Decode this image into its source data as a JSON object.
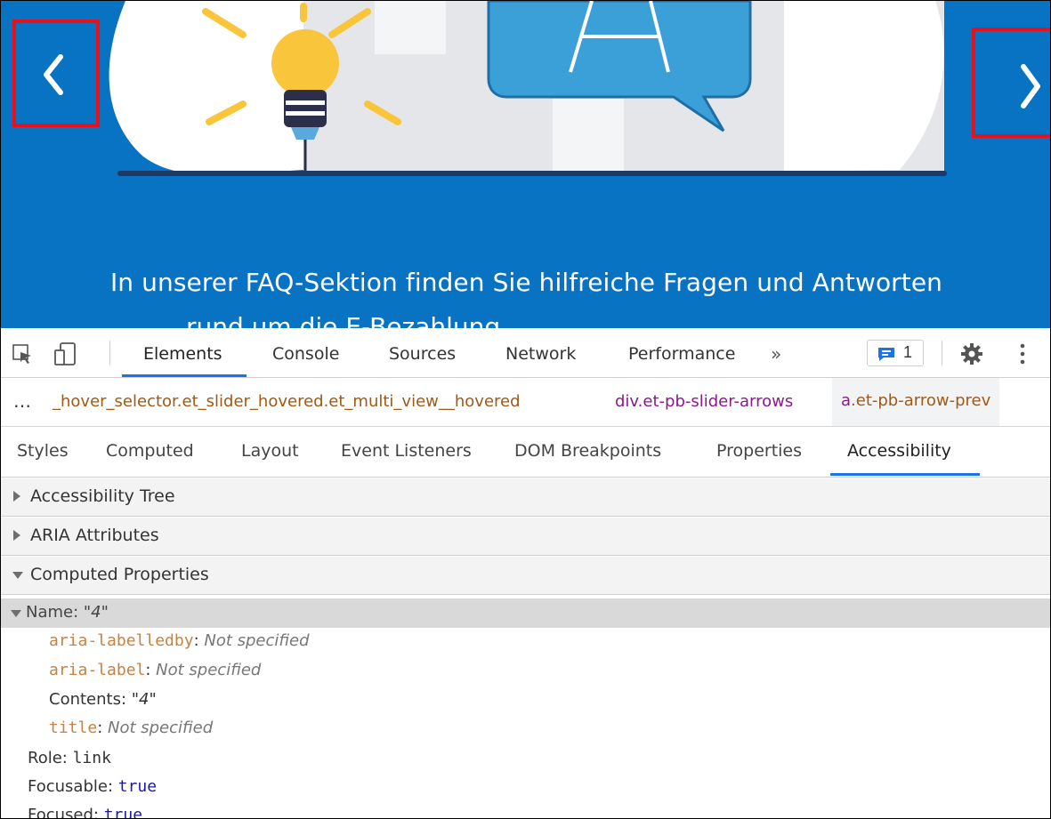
{
  "banner": {
    "headline": "In unserer FAQ-Sektion finden Sie hilfreiche Fragen und Antworten",
    "headline_cont": "rund um die E-Bezahlung",
    "colors": {
      "background": "#0872c3",
      "highlight": "#e8101a"
    },
    "prev_icon": "chevron-left-icon",
    "next_icon": "chevron-right-icon"
  },
  "toolbar": {
    "tabs": [
      "Elements",
      "Console",
      "Sources",
      "Network",
      "Performance"
    ],
    "more": "»",
    "issues_count": "1",
    "icons": [
      "inspect-icon",
      "device-toggle-icon",
      "issues-icon",
      "gear-icon",
      "kebab-menu-icon"
    ]
  },
  "breadcrumbs": {
    "ellipsis": "…",
    "items": [
      "_hover_selector.et_slider_hovered.et_multi_view__hovered",
      "div.et-pb-slider-arrows"
    ],
    "selected_tag": "a",
    "selected_class": ".et-pb-arrow-prev"
  },
  "subtabs": [
    "Styles",
    "Computed",
    "Layout",
    "Event Listeners",
    "DOM Breakpoints",
    "Properties",
    "Accessibility"
  ],
  "sections": [
    "Accessibility Tree",
    "ARIA Attributes",
    "Computed Properties"
  ],
  "computed": {
    "name_label": "Name: ",
    "name_value": "\"4\"",
    "labelledby_key": "aria-labelledby",
    "labelledby_value": "Not specified",
    "label_key": "aria-label",
    "label_value": "Not specified",
    "contents_label": "Contents: ",
    "contents_value": "\"4\"",
    "title_key": "title",
    "title_value": "Not specified",
    "role_label": "Role: ",
    "role_value": "link",
    "focusable_label": "Focusable: ",
    "focusable_value": "true",
    "focused_label": "Focused: ",
    "focused_value": "true"
  }
}
